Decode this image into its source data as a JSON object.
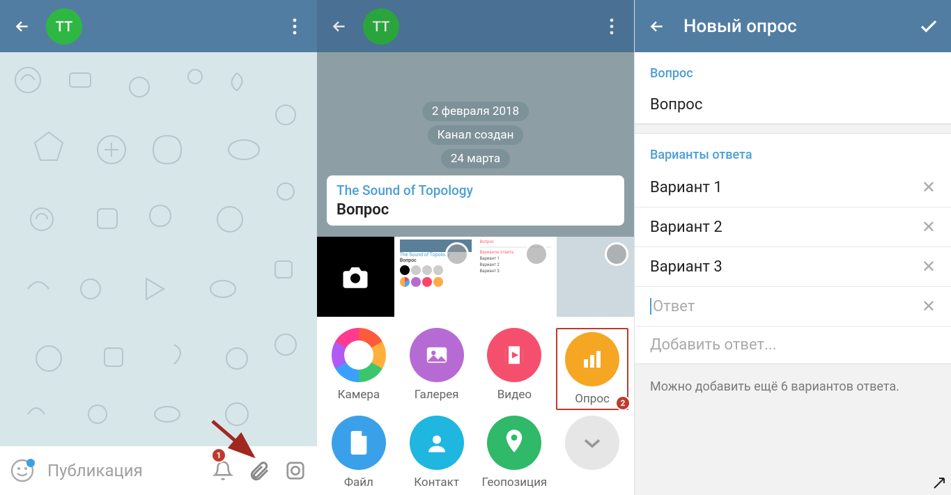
{
  "pane1": {
    "avatar_initials": "TT",
    "input_placeholder": "Публикация"
  },
  "pane2": {
    "avatar_initials": "TT",
    "date1": "2 февраля 2018",
    "system1": "Канал создан",
    "date2": "24 марта",
    "poll_channel": "The Sound of Topology",
    "poll_question": "Вопрос",
    "attach": {
      "camera": "Камера",
      "gallery": "Галерея",
      "video": "Видео",
      "poll": "Опрос",
      "file": "Файл",
      "contact": "Контакт",
      "location": "Геопозиция"
    }
  },
  "pane3": {
    "title": "Новый опрос",
    "question_label": "Вопрос",
    "question_placeholder": "Вопрос",
    "options_label": "Варианты ответа",
    "options": [
      "Вариант 1",
      "Вариант 2",
      "Вариант 3"
    ],
    "answer_placeholder": "Ответ",
    "add_answer": "Добавить ответ...",
    "hint": "Можно добавить ещё 6 вариантов ответа."
  },
  "annotations": {
    "badge1": "1",
    "badge2": "2"
  }
}
